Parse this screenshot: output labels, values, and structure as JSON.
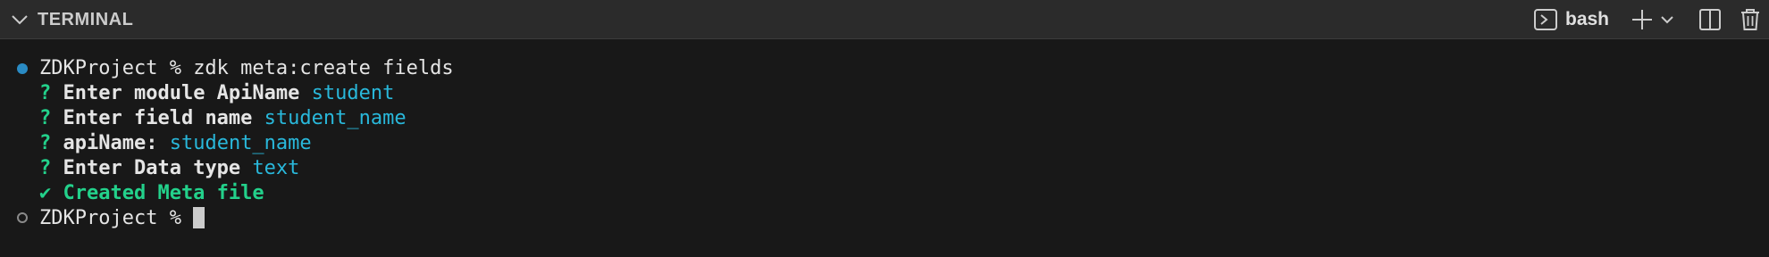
{
  "header": {
    "title": "TERMINAL",
    "shell_name": "bash"
  },
  "terminal": {
    "command_line": {
      "prompt": "ZDKProject % ",
      "command": "zdk meta:create fields"
    },
    "prompts": [
      {
        "marker": "? ",
        "question": "Enter module ApiName",
        "answer": "student"
      },
      {
        "marker": "? ",
        "question": "Enter field name",
        "answer": "student_name"
      },
      {
        "marker": "? ",
        "question": "apiName:",
        "answer": "student_name"
      },
      {
        "marker": "? ",
        "question": "Enter Data type",
        "answer": "text"
      }
    ],
    "success_line": "✔ Created Meta file",
    "current_prompt": "ZDKProject % "
  },
  "colors": {
    "panel_bg": "#181818",
    "header_bg": "#2b2b2b",
    "prompt_green": "#23d18b",
    "answer_cyan": "#29b8db",
    "status_dot_blue": "#2a8bc4"
  }
}
